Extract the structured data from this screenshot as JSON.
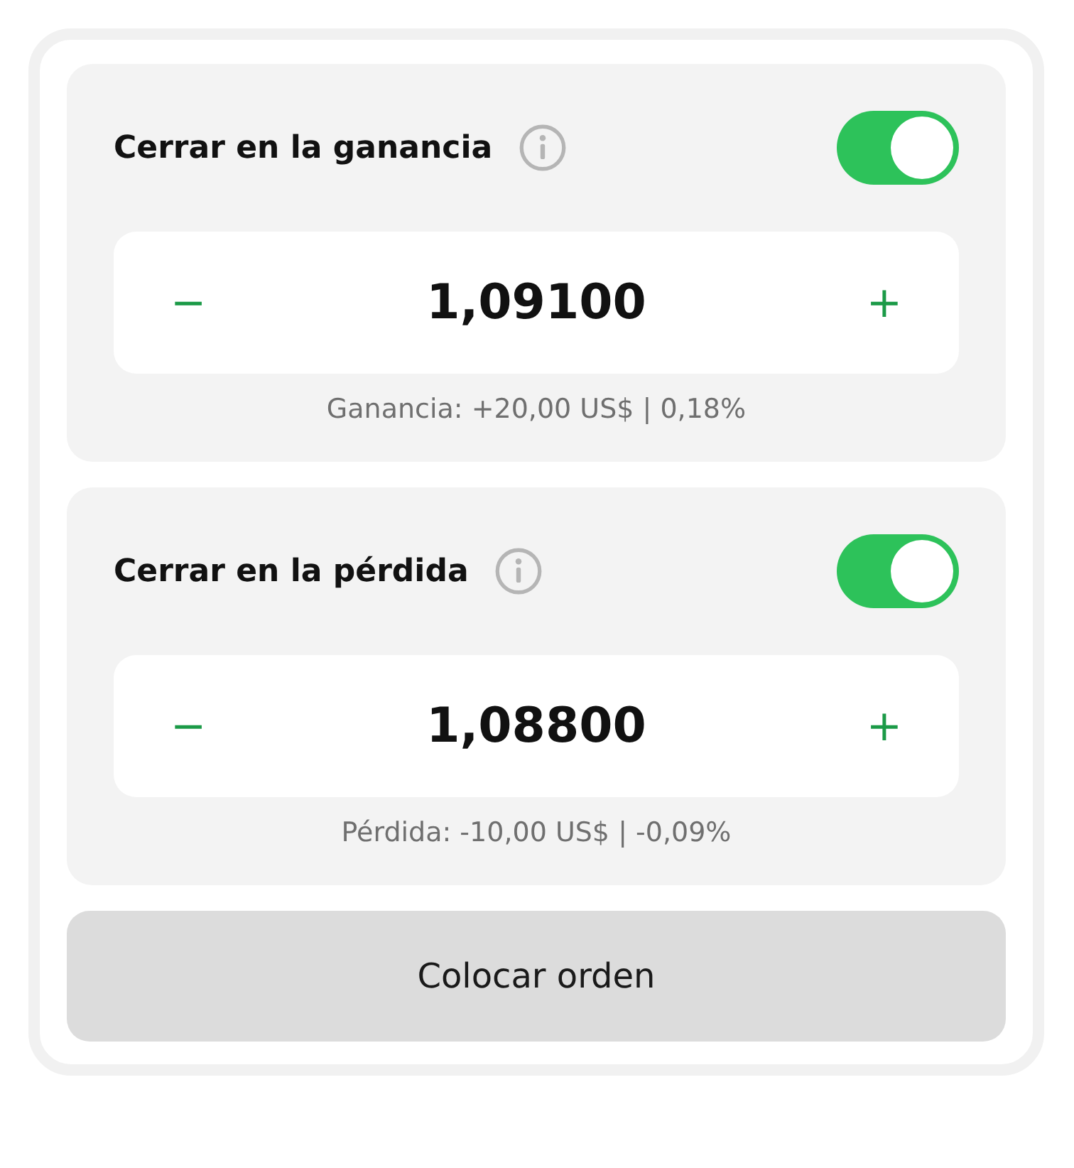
{
  "sections": [
    {
      "title": "Cerrar en la ganancia",
      "on": true,
      "minus": "−",
      "value": "1,09100",
      "plus": "+",
      "caption": "Ganancia: +20,00 US$ | 0,18%"
    },
    {
      "title": "Cerrar en la pérdida",
      "on": true,
      "minus": "−",
      "value": "1,08800",
      "plus": "+",
      "caption": "Pérdida: -10,00 US$ | -0,09%"
    }
  ],
  "button": "Colocar orden"
}
